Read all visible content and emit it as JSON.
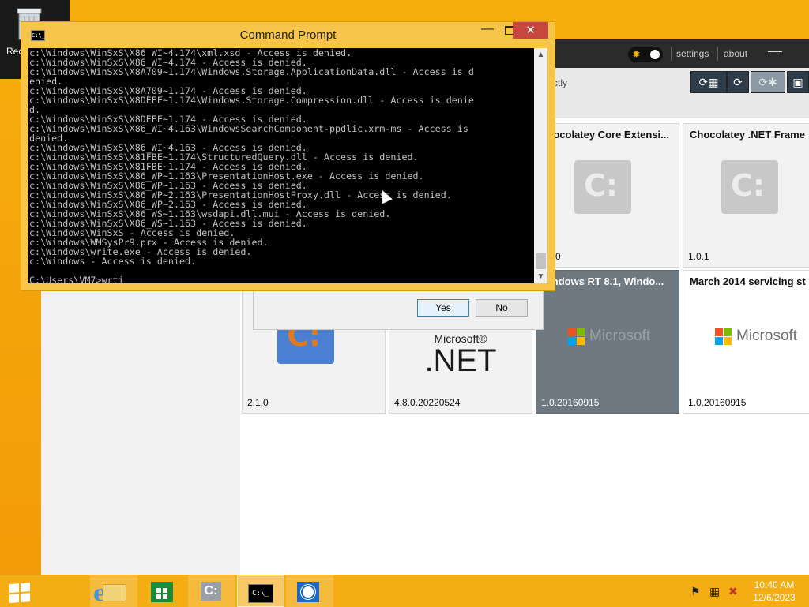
{
  "desktop": {
    "recycle_bin_label": "Rec"
  },
  "choco_window": {
    "title_links": {
      "settings": "settings",
      "about": "about"
    },
    "toolbar_partial_text": "ctly",
    "tiles": [
      {
        "title": "Chocolatey Core Extensi...",
        "version": "0",
        "logo": "chocolatey-logo",
        "style": "light"
      },
      {
        "title": "Chocolatey .NET Frame",
        "version": "1.0.1",
        "logo": "chocolatey-logo",
        "style": "light"
      },
      {
        "title": "",
        "version": "2.1.0",
        "logo": "chocolatey-blue-logo",
        "style": "light"
      },
      {
        "title": "",
        "version": "4.8.0.20220524",
        "logo": "dotnet-logo",
        "style": "light"
      },
      {
        "title": "Windows RT 8.1, Windo...",
        "version": "1.0.20160915",
        "logo": "microsoft-logo",
        "style": "dark"
      },
      {
        "title": "March 2014 servicing st",
        "version": "1.0.20160915",
        "logo": "microsoft-logo",
        "style": "light"
      }
    ],
    "logo_text": {
      "microsoft": "Microsoft",
      "microsoft_small": "Microsoft®",
      "net": ".NET",
      "choco_glyph": "C:"
    }
  },
  "dialog": {
    "yes_label": "Yes",
    "no_label": "No"
  },
  "cmd": {
    "title": "Command Prompt",
    "icon_text": "C:\\_",
    "close_glyph": "✕",
    "min_glyph": "—",
    "output": "c:\\Windows\\WinSxS\\X86_WI~4.174\\xml.xsd - Access is denied.\nc:\\Windows\\WinSxS\\X86_WI~4.174 - Access is denied.\nc:\\Windows\\WinSxS\\X8A709~1.174\\Windows.Storage.ApplicationData.dll - Access is d\nenied.\nc:\\Windows\\WinSxS\\X8A709~1.174 - Access is denied.\nc:\\Windows\\WinSxS\\X8DEEE~1.174\\Windows.Storage.Compression.dll - Access is denie\nd.\nc:\\Windows\\WinSxS\\X8DEEE~1.174 - Access is denied.\nc:\\Windows\\WinSxS\\X86_WI~4.163\\WindowsSearchComponent-ppdlic.xrm-ms - Access is\ndenied.\nc:\\Windows\\WinSxS\\X86_WI~4.163 - Access is denied.\nc:\\Windows\\WinSxS\\X81FBE~1.174\\StructuredQuery.dll - Access is denied.\nc:\\Windows\\WinSxS\\X81FBE~1.174 - Access is denied.\nc:\\Windows\\WinSxS\\X86_WP~1.163\\PresentationHost.exe - Access is denied.\nc:\\Windows\\WinSxS\\X86_WP~1.163 - Access is denied.\nc:\\Windows\\WinSxS\\X86_WP~2.163\\PresentationHostProxy.dll - Access is denied.\nc:\\Windows\\WinSxS\\X86_WP~2.163 - Access is denied.\nc:\\Windows\\WinSxS\\X86_WS~1.163\\wsdapi.dll.mui - Access is denied.\nc:\\Windows\\WinSxS\\X86_WS~1.163 - Access is denied.\nc:\\Windows\\WinSxS - Access is denied.\nc:\\Windows\\WMSysPr9.prx - Access is denied.\nc:\\Windows\\write.exe - Access is denied.\nc:\\Windows - Access is denied.\n\nC:\\Users\\VM7>wrti"
  },
  "taskbar": {
    "items": [
      "start-button",
      "internet-explorer",
      "file-explorer",
      "store",
      "chocolatey-gui",
      "command-prompt",
      "settings-app"
    ],
    "clock_time": "10:40 AM",
    "clock_date": "12/6/2023"
  },
  "colors": {
    "desktop": "#f6ae0e",
    "cmd_frame": "#f6c54a",
    "close_button": "#c7463d",
    "choco_dark_tile": "#6f7982"
  }
}
